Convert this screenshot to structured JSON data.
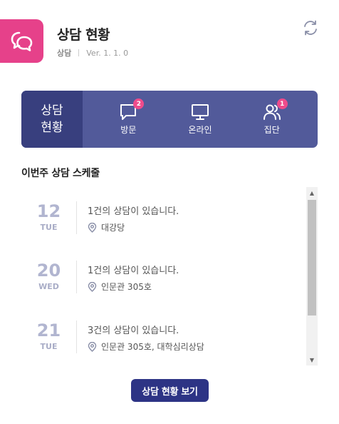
{
  "header": {
    "title": "상담 현황",
    "app_name": "상담",
    "version": "Ver. 1. 1. 0",
    "logo_icon": "chat-bubbles-icon",
    "refresh_icon": "refresh-icon"
  },
  "status": {
    "main_label_line1": "상담",
    "main_label_line2": "현황",
    "items": [
      {
        "label": "방문",
        "icon": "chat-icon",
        "badge": "2"
      },
      {
        "label": "온라인",
        "icon": "monitor-icon",
        "badge": ""
      },
      {
        "label": "집단",
        "icon": "users-icon",
        "badge": "1"
      }
    ]
  },
  "schedule": {
    "title": "이번주 상담 스케줄",
    "items": [
      {
        "day": "12",
        "weekday": "TUE",
        "count_num": "1",
        "count_text": "건의 상담이 있습니다.",
        "location": "대강당"
      },
      {
        "day": "20",
        "weekday": "WED",
        "count_num": "1",
        "count_text": "건의 상담이 있습니다.",
        "location": "인문관 305호"
      },
      {
        "day": "21",
        "weekday": "TUE",
        "count_num": "3",
        "count_text": "건의 상담이 있습니다.",
        "location": "인문관 305호, 대학심리상담"
      }
    ]
  },
  "footer": {
    "button_label": "상담 현황 보기"
  },
  "colors": {
    "brand_pink": "#e6418a",
    "navy": "#2d3485",
    "status_bg": "#525a9a",
    "status_main_bg": "#383f7e"
  }
}
